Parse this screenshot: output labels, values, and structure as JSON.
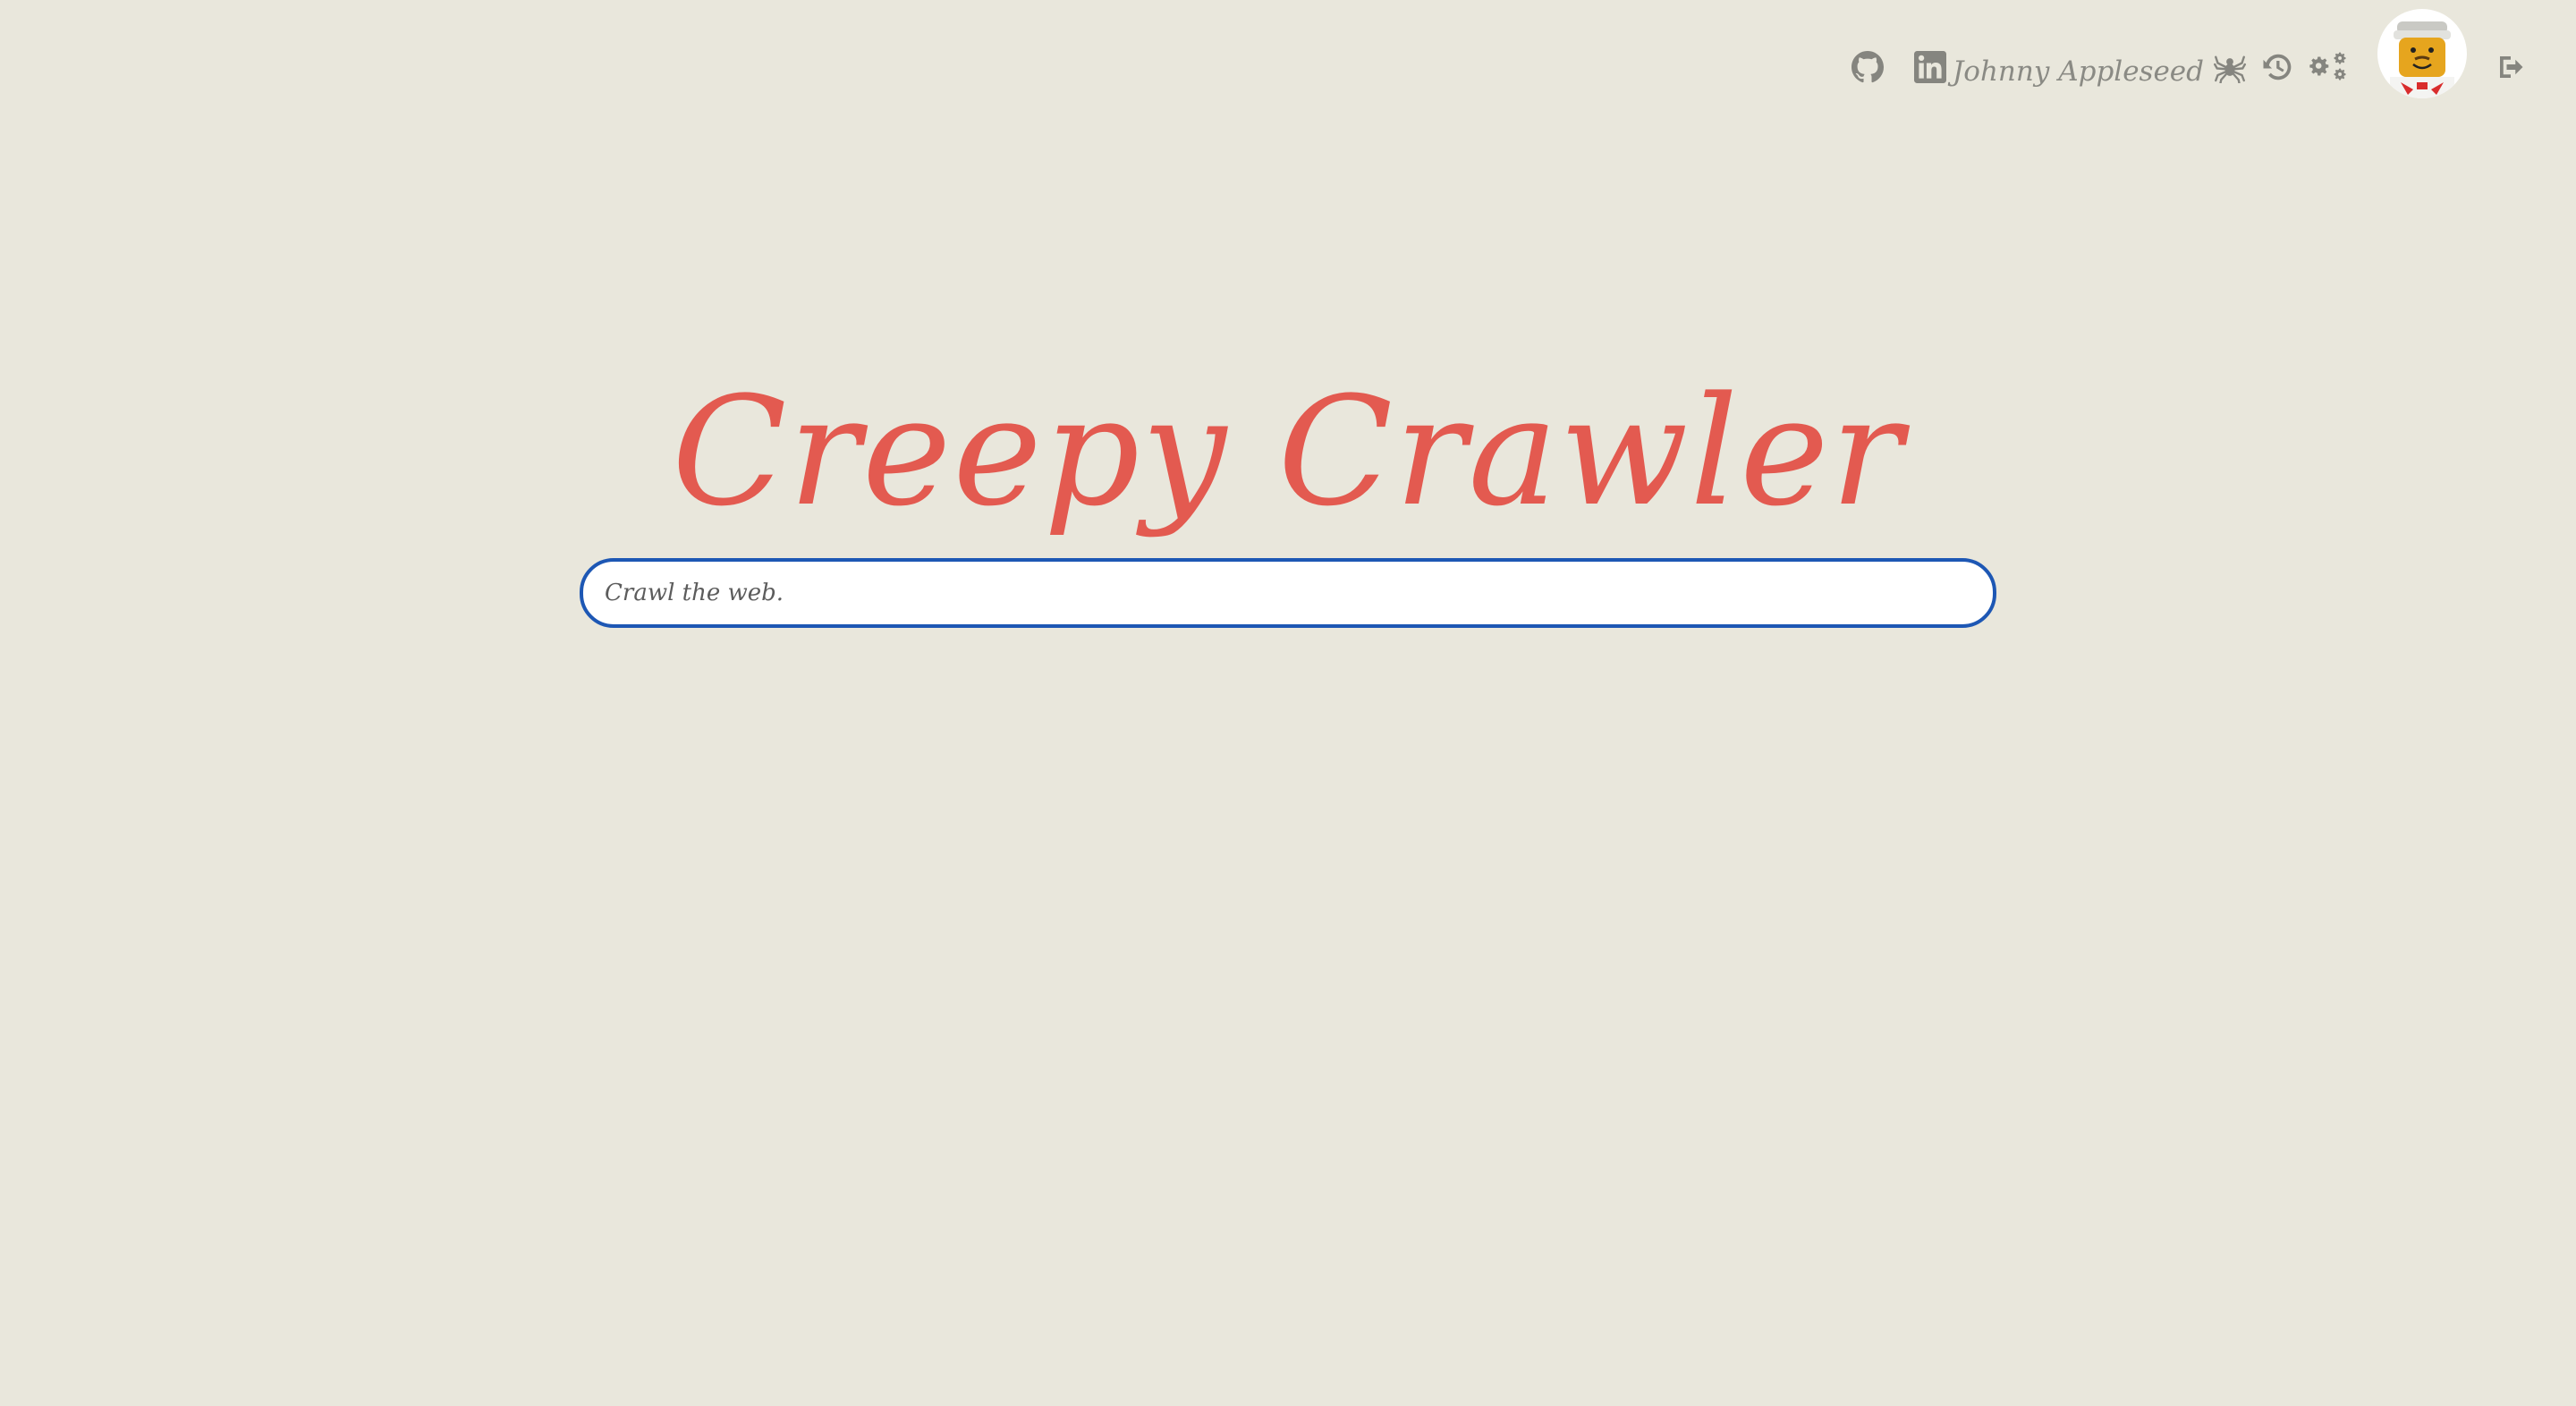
{
  "header": {
    "user_name": "Johnny Appleseed",
    "icons": {
      "github": "github-icon",
      "linkedin": "linkedin-icon",
      "spider": "spider-icon",
      "history": "history-icon",
      "settings": "gears-icon",
      "logout": "sign-out-icon"
    },
    "icon_color": "#85857f"
  },
  "main": {
    "title": "Creepy Crawler",
    "title_color": "#e35a50",
    "search": {
      "placeholder": "Crawl the web.",
      "value": "",
      "border_color": "#1d57b4"
    }
  },
  "theme": {
    "background": "#e9e7dc"
  }
}
